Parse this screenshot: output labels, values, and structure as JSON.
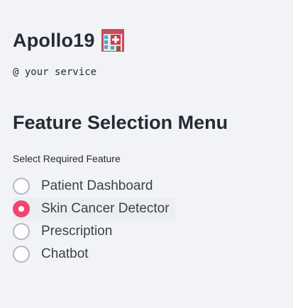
{
  "app": {
    "title": "Apollo19",
    "title_icon": "hospital-icon",
    "tagline": "@ your service"
  },
  "menu": {
    "heading": "Feature Selection Menu",
    "radio_label": "Select Required Feature",
    "selected": "Skin Cancer Detector",
    "options": [
      {
        "label": "Patient Dashboard",
        "checked": false
      },
      {
        "label": "Skin Cancer Detector",
        "checked": true
      },
      {
        "label": "Prescription",
        "checked": false
      },
      {
        "label": "Chatbot",
        "checked": false
      }
    ]
  },
  "colors": {
    "background": "#f2f3f7",
    "accent": "#f0466e",
    "text": "#272a35"
  }
}
